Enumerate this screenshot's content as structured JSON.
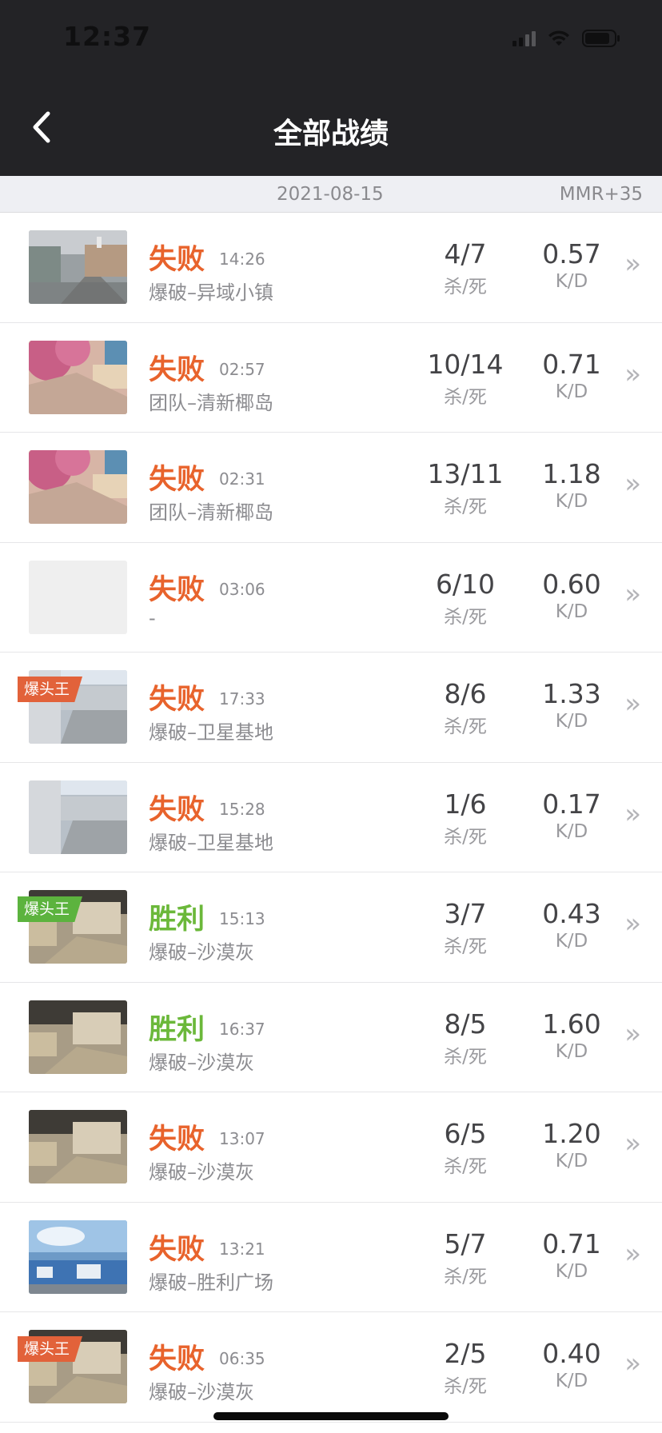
{
  "status_bar": {
    "time": "12:37"
  },
  "header": {
    "title": "全部战绩"
  },
  "summary": {
    "date": "2021-08-15",
    "mmr": "MMR+35"
  },
  "stat_labels": {
    "kills_label": "杀/死",
    "ratio_label": "K/D"
  },
  "colors": {
    "loss": "#e8632c",
    "win": "#6bb83a",
    "header_bg": "#232326"
  },
  "matches": [
    {
      "result": "失败",
      "outcome": "loss",
      "time": "14:26",
      "mode": "爆破–异域小镇",
      "kills": "4/7",
      "ratio": "0.57",
      "map_style": "town",
      "badge": "",
      "badge_color": ""
    },
    {
      "result": "失败",
      "outcome": "loss",
      "time": "02:57",
      "mode": "团队–清新椰岛",
      "kills": "10/14",
      "ratio": "0.71",
      "map_style": "island",
      "badge": "",
      "badge_color": ""
    },
    {
      "result": "失败",
      "outcome": "loss",
      "time": "02:31",
      "mode": "团队–清新椰岛",
      "kills": "13/11",
      "ratio": "1.18",
      "map_style": "island",
      "badge": "",
      "badge_color": ""
    },
    {
      "result": "失败",
      "outcome": "loss",
      "time": "03:06",
      "mode": "-",
      "kills": "6/10",
      "ratio": "0.60",
      "map_style": "none",
      "badge": "",
      "badge_color": ""
    },
    {
      "result": "失败",
      "outcome": "loss",
      "time": "17:33",
      "mode": "爆破–卫星基地",
      "kills": "8/6",
      "ratio": "1.33",
      "map_style": "base",
      "badge": "爆头王",
      "badge_color": "red"
    },
    {
      "result": "失败",
      "outcome": "loss",
      "time": "15:28",
      "mode": "爆破–卫星基地",
      "kills": "1/6",
      "ratio": "0.17",
      "map_style": "base",
      "badge": "",
      "badge_color": ""
    },
    {
      "result": "胜利",
      "outcome": "win",
      "time": "15:13",
      "mode": "爆破–沙漠灰",
      "kills": "3/7",
      "ratio": "0.43",
      "map_style": "desert",
      "badge": "爆头王",
      "badge_color": "green"
    },
    {
      "result": "胜利",
      "outcome": "win",
      "time": "16:37",
      "mode": "爆破–沙漠灰",
      "kills": "8/5",
      "ratio": "1.60",
      "map_style": "desert",
      "badge": "",
      "badge_color": ""
    },
    {
      "result": "失败",
      "outcome": "loss",
      "time": "13:07",
      "mode": "爆破–沙漠灰",
      "kills": "6/5",
      "ratio": "1.20",
      "map_style": "desert",
      "badge": "",
      "badge_color": ""
    },
    {
      "result": "失败",
      "outcome": "loss",
      "time": "13:21",
      "mode": "爆破–胜利广场",
      "kills": "5/7",
      "ratio": "0.71",
      "map_style": "plaza",
      "badge": "",
      "badge_color": ""
    },
    {
      "result": "失败",
      "outcome": "loss",
      "time": "06:35",
      "mode": "爆破–沙漠灰",
      "kills": "2/5",
      "ratio": "0.40",
      "map_style": "desert",
      "badge": "爆头王",
      "badge_color": "red"
    }
  ]
}
